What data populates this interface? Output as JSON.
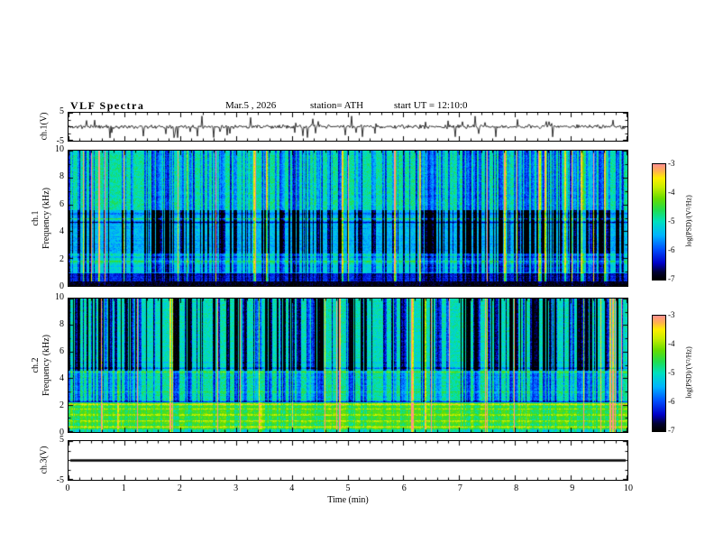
{
  "header": {
    "title": "VLF Spectra",
    "date": "Mar.5 , 2026",
    "station": "station= ATH",
    "start_ut": "start UT = 12:10:0"
  },
  "axes": {
    "time": {
      "label": "Time (min)",
      "min": 0,
      "max": 10,
      "ticks": [
        0,
        1,
        2,
        3,
        4,
        5,
        6,
        7,
        8,
        9,
        10
      ]
    },
    "colorbar": {
      "label": "log(PSD)/(V²/Hz)",
      "min": -7,
      "max": -3,
      "ticks": [
        -3,
        -4,
        -5,
        -6,
        -7
      ]
    }
  },
  "panels": {
    "wave1": {
      "ylabel": "ch.1(V)",
      "ylim": [
        -5,
        5
      ],
      "ytick_labels": [
        5,
        -5
      ]
    },
    "spec1": {
      "ylabel_line1": "ch.1",
      "ylabel_line2": "Frequency (kHz)",
      "ylim": [
        0,
        10
      ],
      "ytick_labels": [
        10,
        8,
        6,
        4,
        2,
        0
      ]
    },
    "spec2": {
      "ylabel_line1": "ch.2",
      "ylabel_line2": "Frequency (kHz)",
      "ylim": [
        0,
        10
      ],
      "ytick_labels": [
        10,
        8,
        6,
        4,
        2,
        0
      ]
    },
    "wave3": {
      "ylabel": "ch.3(V)",
      "ylim": [
        -5,
        5
      ],
      "ytick_labels": [
        5,
        -5
      ]
    }
  },
  "colormap": {
    "stops": [
      {
        "t": 0.0,
        "color": "#000000"
      },
      {
        "t": 0.06,
        "color": "#010130"
      },
      {
        "t": 0.14,
        "color": "#0000c8"
      },
      {
        "t": 0.26,
        "color": "#0050ff"
      },
      {
        "t": 0.38,
        "color": "#00b4ff"
      },
      {
        "t": 0.5,
        "color": "#00e0c0"
      },
      {
        "t": 0.6,
        "color": "#20dd50"
      },
      {
        "t": 0.7,
        "color": "#66dd00"
      },
      {
        "t": 0.8,
        "color": "#c8ee00"
      },
      {
        "t": 0.88,
        "color": "#ffee00"
      },
      {
        "t": 0.94,
        "color": "#ffb050"
      },
      {
        "t": 1.0,
        "color": "#ff9090"
      }
    ]
  },
  "chart_data": [
    {
      "type": "line",
      "panel": "ch1_waveform",
      "ylabel": "ch.1(V)",
      "xlim": [
        0,
        10
      ],
      "ylim": [
        -5,
        5
      ],
      "series_summary": "zero-mean broadband VLF noise about ±1 V with dense impulsive sferic spikes reaching about ±4 V over the 10-minute record",
      "seed": 11
    },
    {
      "type": "heatmap",
      "panel": "ch1_spectrogram",
      "ylabel": "ch.1 Frequency (kHz)",
      "xlim": [
        0,
        10
      ],
      "ylim": [
        0,
        10
      ],
      "zlabel": "log(PSD)/(V²/Hz)",
      "zlim": [
        -7,
        -3
      ],
      "seed": 7,
      "bands": [
        {
          "f": [
            0,
            0.3
          ],
          "psd": -6.9
        },
        {
          "f": [
            0.3,
            0.9
          ],
          "psd": -6.2
        },
        {
          "f": [
            0.9,
            1.6
          ],
          "psd": -5.2
        },
        {
          "f": [
            1.6,
            2.4
          ],
          "psd": -5.0
        },
        {
          "f": [
            2.4,
            3.2
          ],
          "psd": -5.5
        },
        {
          "f": [
            3.2,
            5.6
          ],
          "psd": -5.45
        },
        {
          "f": [
            5.6,
            10
          ],
          "psd": -4.9
        }
      ],
      "lines": [
        {
          "f": 1.78,
          "dpsd": 0.8
        },
        {
          "f": 2.1,
          "dpsd": -0.6
        },
        {
          "f": 4.7,
          "dpsd": -1.0
        },
        {
          "f": 4.95,
          "dpsd": 1.0
        },
        {
          "f": 5.35,
          "dpsd": -0.5
        }
      ],
      "streaks": {
        "bright_fraction": 0.045,
        "dip_fraction": 0.3
      },
      "dip_weight": [
        {
          "f": [
            0,
            0.3
          ],
          "w": 0.0
        },
        {
          "f": [
            0.3,
            1.0
          ],
          "w": 0.3
        },
        {
          "f": [
            1.0,
            2.4
          ],
          "w": 0.6
        },
        {
          "f": [
            2.4,
            5.6
          ],
          "w": 1.0
        },
        {
          "f": [
            5.6,
            10
          ],
          "w": 0.55
        }
      ],
      "bright_weight": [
        {
          "f": [
            0,
            0.3
          ],
          "w": 0.1
        },
        {
          "f": [
            0.3,
            10
          ],
          "w": 0.85
        }
      ]
    },
    {
      "type": "heatmap",
      "panel": "ch2_spectrogram",
      "ylabel": "ch.2 Frequency (kHz)",
      "xlim": [
        0,
        10
      ],
      "ylim": [
        0,
        10
      ],
      "zlabel": "log(PSD)/(V²/Hz)",
      "zlim": [
        -7,
        -3
      ],
      "seed": 23,
      "bands": [
        {
          "f": [
            0,
            0.15
          ],
          "psd": -4.9
        },
        {
          "f": [
            0.15,
            2.3
          ],
          "psd": -4.35
        },
        {
          "f": [
            2.3,
            4.6
          ],
          "psd": -4.85
        },
        {
          "f": [
            4.6,
            10
          ],
          "psd": -5.0
        }
      ],
      "lines": [
        {
          "f": 0.35,
          "dpsd": 0.9
        },
        {
          "f": 0.8,
          "dpsd": 0.7
        },
        {
          "f": 1.25,
          "dpsd": 0.8
        },
        {
          "f": 1.7,
          "dpsd": 0.6
        },
        {
          "f": 2.05,
          "dpsd": 1.0
        },
        {
          "f": 2.25,
          "dpsd": -1.8
        },
        {
          "f": 3.0,
          "dpsd": 0.35
        },
        {
          "f": 4.5,
          "dpsd": 0.7
        },
        {
          "f": 4.78,
          "dpsd": -1.1
        },
        {
          "f": 5.2,
          "dpsd": -0.35
        }
      ],
      "streaks": {
        "bright_fraction": 0.03,
        "dip_fraction": 0.28
      },
      "dip_weight": [
        {
          "f": [
            0,
            2.3
          ],
          "w": 0.2
        },
        {
          "f": [
            2.3,
            4.6
          ],
          "w": 0.55
        },
        {
          "f": [
            4.6,
            10
          ],
          "w": 1.0
        }
      ],
      "bright_weight": [
        {
          "f": [
            0,
            2.3
          ],
          "w": 0.5
        },
        {
          "f": [
            2.3,
            10
          ],
          "w": 0.6
        }
      ]
    },
    {
      "type": "line",
      "panel": "ch3_waveform",
      "ylabel": "ch.3(V)",
      "xlim": [
        0,
        10
      ],
      "ylim": [
        -5,
        5
      ],
      "series_summary": "constant 0 V (flat thick black line, no signal on channel 3)",
      "seed": 0
    }
  ]
}
